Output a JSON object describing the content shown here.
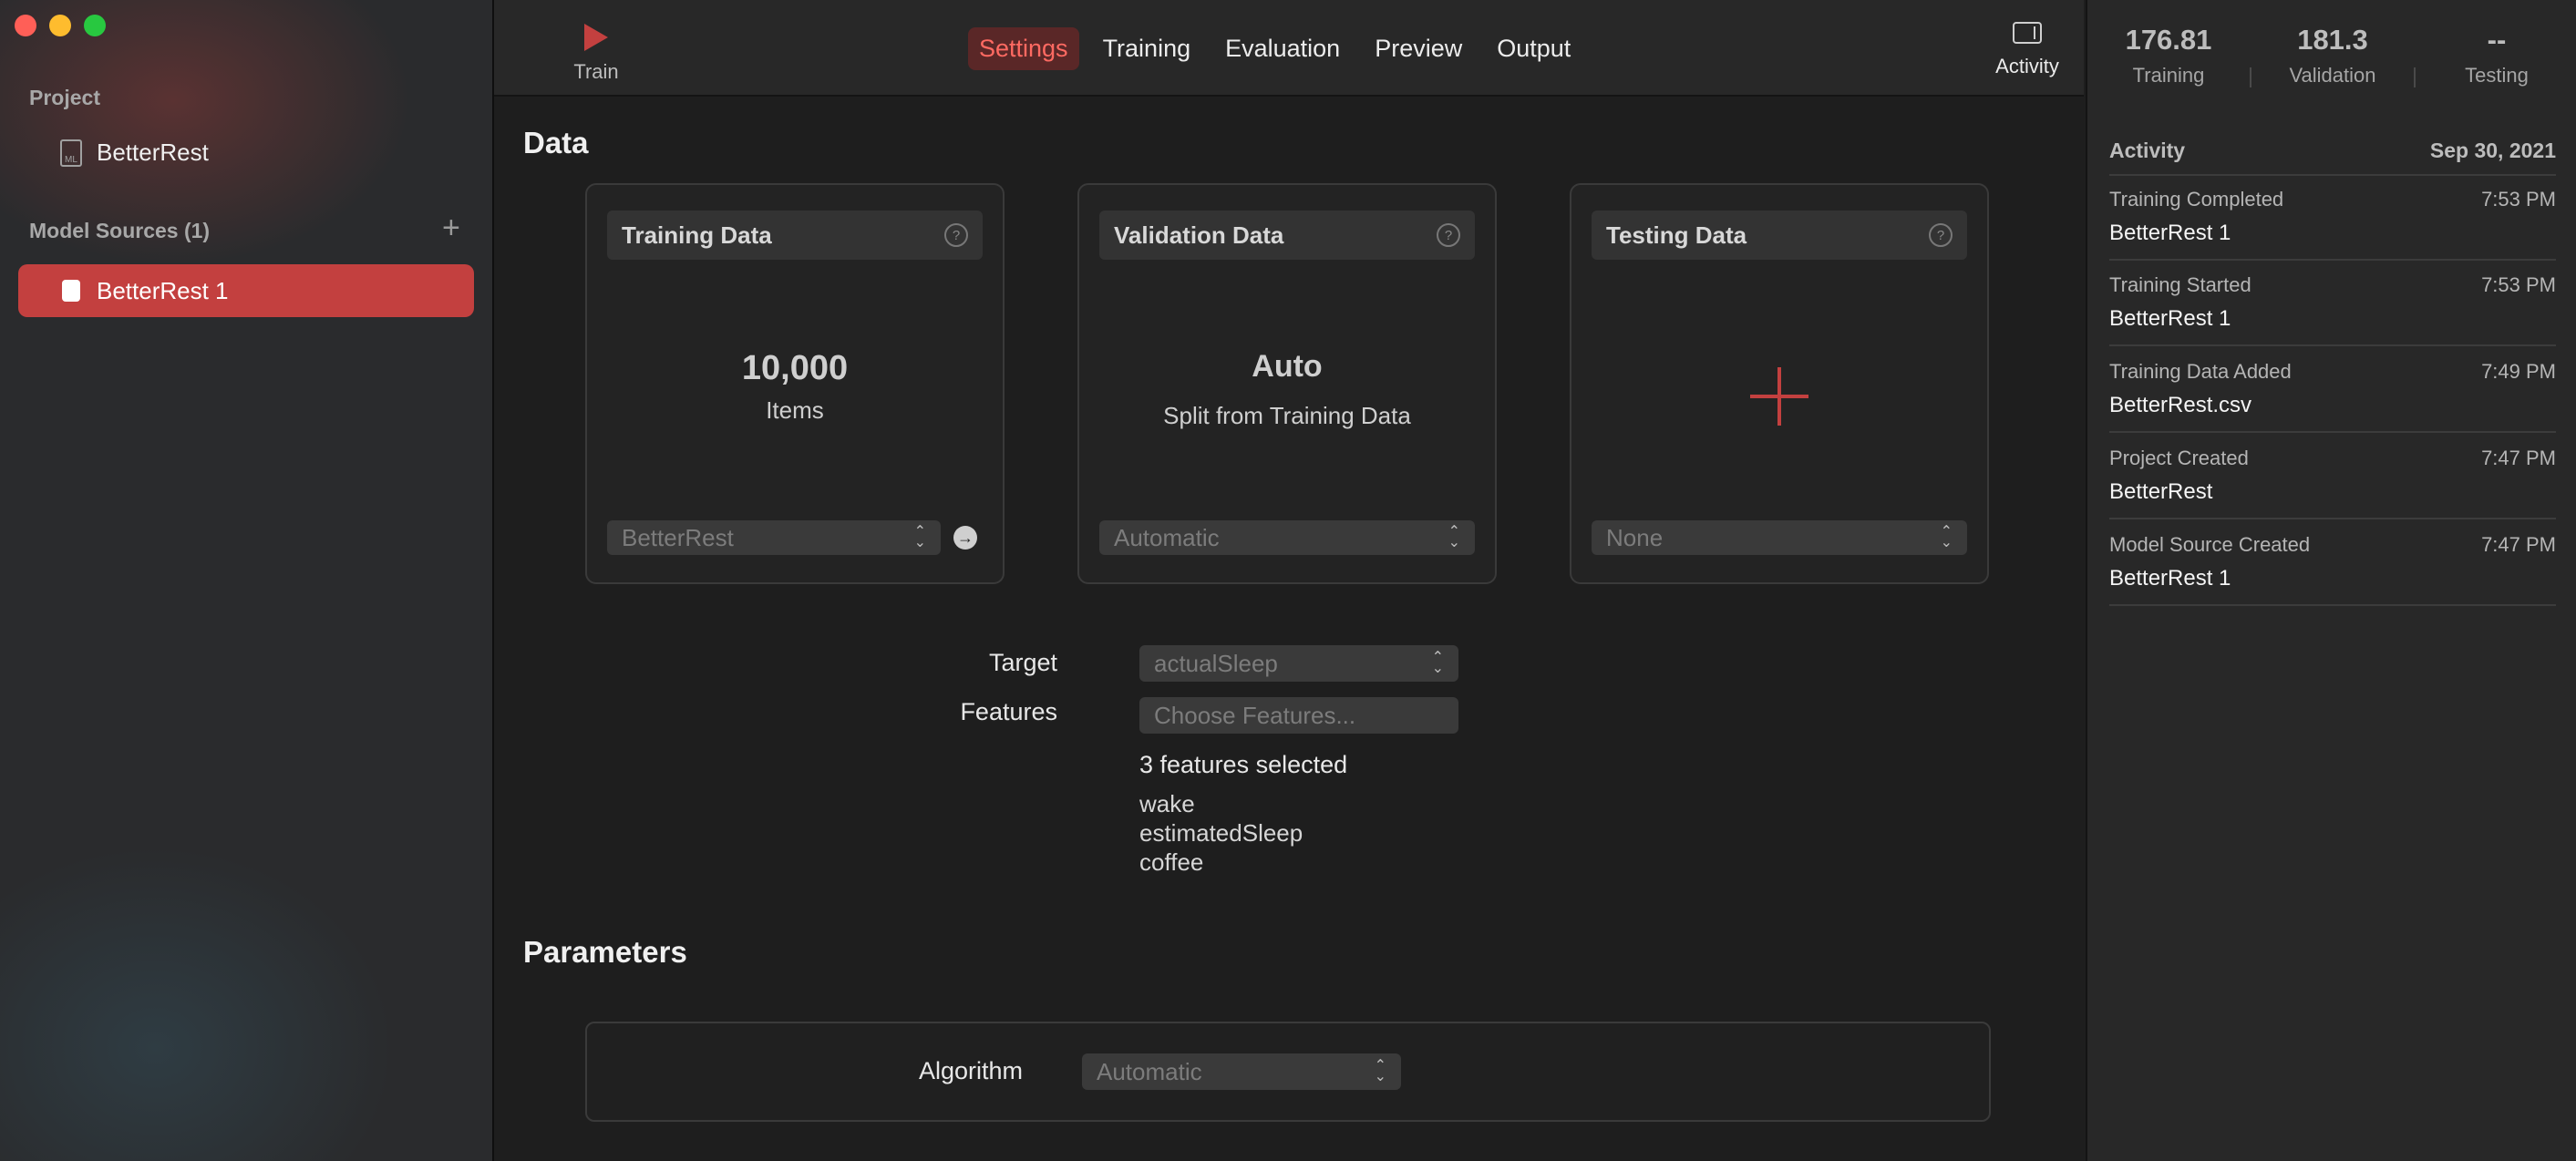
{
  "sidebar": {
    "project_heading": "Project",
    "project_name": "BetterRest",
    "project_icon_text": "ML",
    "model_sources_heading": "Model Sources (1)",
    "add_symbol": "+",
    "selected_source": "BetterRest 1"
  },
  "toolbar": {
    "train_label": "Train",
    "tabs": [
      "Settings",
      "Training",
      "Evaluation",
      "Preview",
      "Output"
    ],
    "active_tab": "Settings",
    "activity_label": "Activity"
  },
  "main": {
    "data_heading": "Data",
    "training_card": {
      "title": "Training Data",
      "count": "10,000",
      "count_label": "Items",
      "source": "BetterRest"
    },
    "validation_card": {
      "title": "Validation Data",
      "mode": "Auto",
      "description": "Split from Training Data",
      "option": "Automatic"
    },
    "testing_card": {
      "title": "Testing Data",
      "option": "None"
    },
    "target_label": "Target",
    "target_value": "actualSleep",
    "features_label": "Features",
    "features_placeholder": "Choose Features...",
    "features_selected": "3 features selected",
    "features": [
      "wake",
      "estimatedSleep",
      "coffee"
    ],
    "parameters_heading": "Parameters",
    "algorithm_label": "Algorithm",
    "algorithm_value": "Automatic"
  },
  "metrics": {
    "training_value": "176.81",
    "training_label": "Training",
    "validation_value": "181.3",
    "validation_label": "Validation",
    "testing_value": "--",
    "testing_label": "Testing"
  },
  "activity": {
    "heading": "Activity",
    "date": "Sep 30, 2021",
    "events": [
      {
        "event": "Training Completed",
        "time": "7:53 PM",
        "subject": "BetterRest 1"
      },
      {
        "event": "Training Started",
        "time": "7:53 PM",
        "subject": "BetterRest 1"
      },
      {
        "event": "Training Data Added",
        "time": "7:49 PM",
        "subject": "BetterRest.csv"
      },
      {
        "event": "Project Created",
        "time": "7:47 PM",
        "subject": "BetterRest"
      },
      {
        "event": "Model Source Created",
        "time": "7:47 PM",
        "subject": "BetterRest 1"
      }
    ]
  },
  "colors": {
    "accent": "#c3403f",
    "active_tab_text": "#ff6a62"
  }
}
